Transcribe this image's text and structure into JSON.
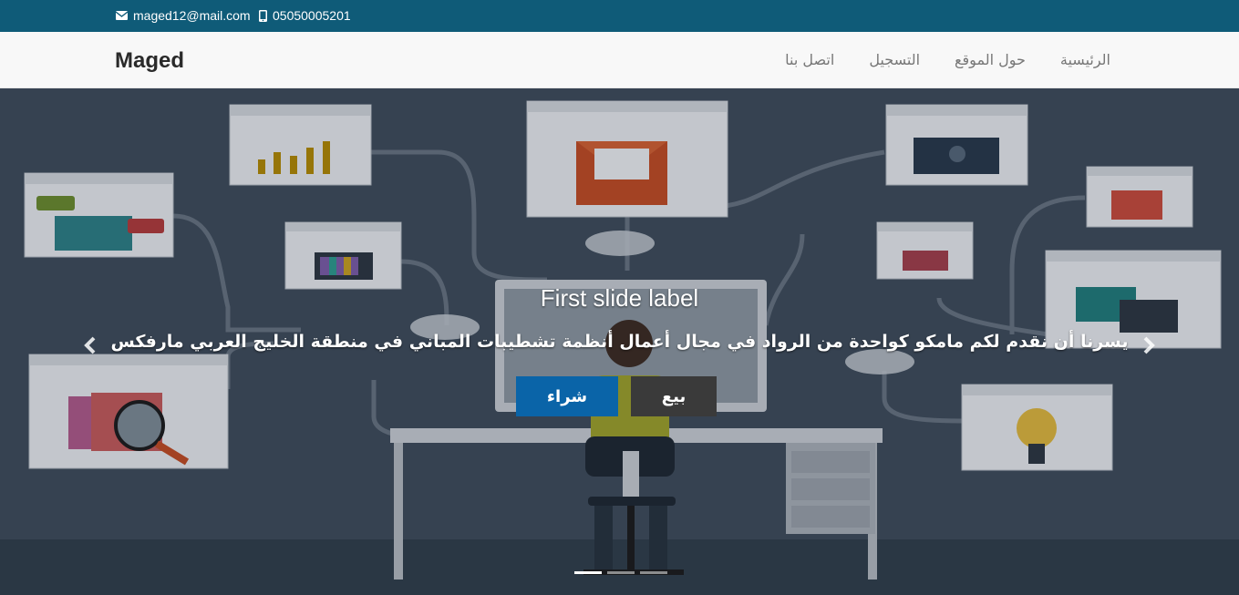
{
  "topbar": {
    "email": "maged12@mail.com",
    "phone": "05050005201"
  },
  "navbar": {
    "brand": "Maged",
    "links": [
      "الرئيسية",
      "حول الموقع",
      "التسجيل",
      "اتصل بنا"
    ]
  },
  "carousel": {
    "title": "First slide label",
    "text": "يسرنا أن نقدم لكم مامكو كواحدة من الرواد في مجال أعمال أنظمة تشطيبات المباني في منطقة الخليج العربي مارفكس",
    "buy_label": "شراء",
    "sell_label": "بيع",
    "prev_icon": "chevron-left-icon",
    "next_icon": "chevron-right-icon",
    "indicator_count": 3,
    "active_indicator": 0
  },
  "colors": {
    "topbar": "#0f5b78",
    "buy_button": "#0a64a8",
    "sell_button": "#3a3a3a",
    "hero_background": "#3c4a59"
  }
}
